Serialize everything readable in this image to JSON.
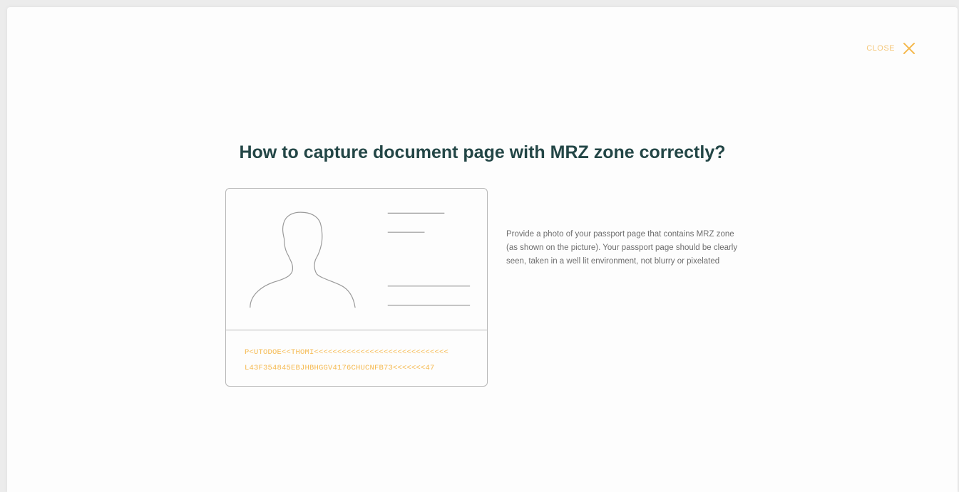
{
  "header": {
    "close_label": "CLOSE",
    "close_icon": "close-icon"
  },
  "main": {
    "title": "How to capture document page with MRZ zone correctly?",
    "description": "Provide a photo of your passport page that contains MRZ zone (as shown on the picture). Your passport page should be clearly seen, taken in a well lit environment, not blurry or pixelated",
    "document_illustration": {
      "icon": "passport-document-icon",
      "mrz_lines": [
        "P<UTODOE<<THOMI<<<<<<<<<<<<<<<<<<<<<<<<<<<<<",
        "L43F354845EBJHBHGGV4176CHUCNFB73<<<<<<<47"
      ]
    }
  },
  "colors": {
    "title": "#234646",
    "accent": "#f5b94f",
    "text": "#6e6e6e",
    "line": "#b8b8b8",
    "background": "#fdfdfd"
  }
}
